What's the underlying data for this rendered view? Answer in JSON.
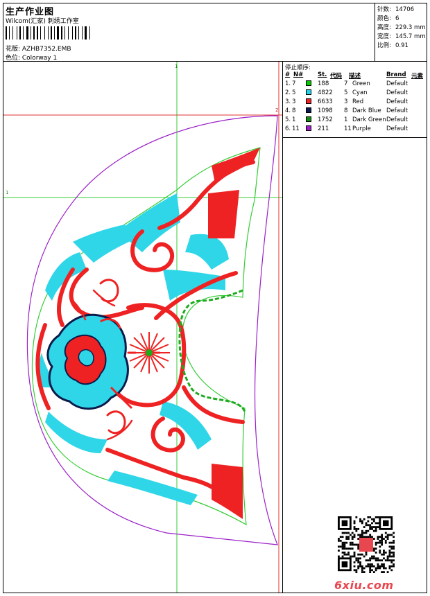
{
  "header": {
    "title": "生产作业图",
    "company": "Wilcom(汇家) 刺绣工作室",
    "design_label": "花版: AZHB7352.EMB",
    "colorway_label": "色位: Colorway 1"
  },
  "stats": [
    {
      "key": "针数:",
      "value": "14706"
    },
    {
      "key": "颜色:",
      "value": "6"
    },
    {
      "key": "高度:",
      "value": "229.3 mm"
    },
    {
      "key": "宽度:",
      "value": "145.7 mm"
    },
    {
      "key": "比例:",
      "value": "0.91"
    }
  ],
  "stop_sequence": {
    "title": "停止顺序:",
    "headers": {
      "num": "#",
      "n": "N#",
      "st": "St.",
      "code": "代码",
      "desc": "描述",
      "brand": "Brand",
      "elem": "元素"
    },
    "rows": [
      {
        "idx": "1.",
        "n": "7",
        "st": "188",
        "code": "7",
        "desc": "Green",
        "brand": "Default",
        "color": "#00cc00"
      },
      {
        "idx": "2.",
        "n": "5",
        "st": "4822",
        "code": "5",
        "desc": "Cyan",
        "brand": "Default",
        "color": "#22d3e6"
      },
      {
        "idx": "3.",
        "n": "3",
        "st": "6633",
        "code": "3",
        "desc": "Red",
        "brand": "Default",
        "color": "#ee2222"
      },
      {
        "idx": "4.",
        "n": "8",
        "st": "1098",
        "code": "8",
        "desc": "Dark Blue",
        "brand": "Default",
        "color": "#0a1a4a"
      },
      {
        "idx": "5.",
        "n": "1",
        "st": "1752",
        "code": "1",
        "desc": "Dark Green",
        "brand": "Default",
        "color": "#138a13"
      },
      {
        "idx": "6.",
        "n": "11",
        "st": "211",
        "code": "11",
        "desc": "Purple",
        "brand": "Default",
        "color": "#9b1fc7"
      }
    ]
  },
  "guides": {
    "v1": "1",
    "h1": "1",
    "h2": "2"
  },
  "watermark": "6xiu.com",
  "colors": {
    "red": "#ee2222",
    "cyan": "#2fd6e8",
    "green": "#1faa1f",
    "purple": "#9b1fc7",
    "darkblue": "#0a1a4a",
    "outline": "#33cc33"
  }
}
